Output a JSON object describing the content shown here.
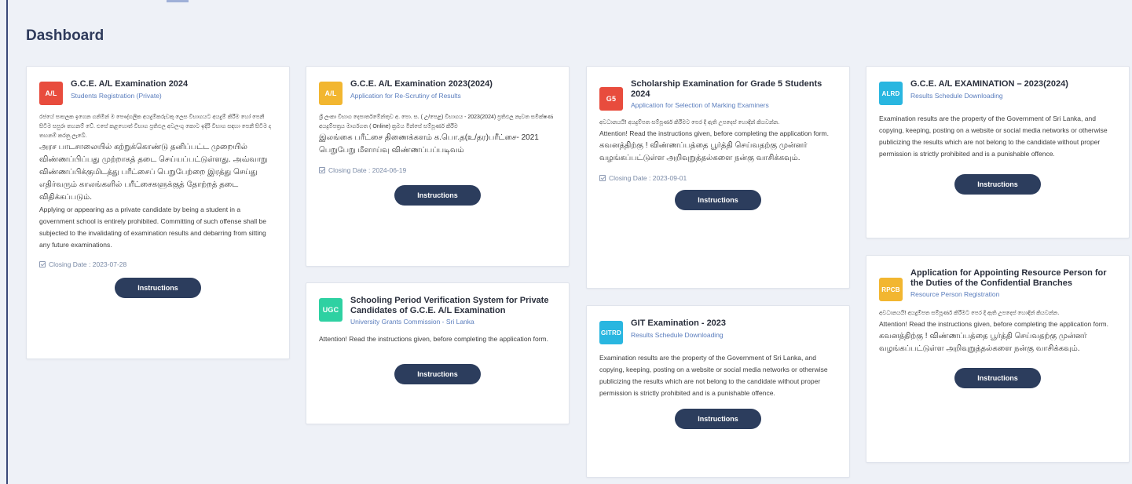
{
  "page": {
    "title": "Dashboard"
  },
  "instructions_label": "Instructions",
  "cards": {
    "al2024": {
      "badge": "A/L",
      "badge_color": "#e84c3d",
      "title": "G.C.E. A/L Examination 2024",
      "subtitle": "Students Registration (Private)",
      "sinhala": "රජයේ පාසලක ඉගෙන ගනිමින් ම පෞද්ගලික අයදුම්කරුවකු ලෙස විභාගයට අයදුම් කිරීම හෝ පෙනී සිටීම සපුරා තහනම් වේ. එසේ කළහොත් විභාග ප්‍රතිඵල අවලංගු කොට ඉදිරි විභාග සඳහා පෙනී සිටීම ද තහනම් කරනු ලැබේ.",
      "tamil": "அரச பாடசாலையில் கற்றுக்கொண்டு தனிப்பட்ட முறையில் விண்ணப்பிப்பது முற்றாகத் தடை செய்யப்பட்டுள்ளது. அவ்வாறு விண்ணப்பிக்குமிடத்து பரீட்சைப் பெறுபேற்றை இரத்து செய்து எதிர்வரும் காலங்களில் பரீட்சைகளுக்குத் தோற்றத் தடை விதிக்கப்படும்.",
      "english": "Applying or appearing as a private candidate by being a student in a government school is entirely prohibited. Committing of such offense shall be subjected to the invalidating of examination results and debarring from sitting any future examinations.",
      "closing": "Closing Date : 2023-07-28"
    },
    "al2023": {
      "badge": "A/L",
      "badge_color": "#f2b630",
      "title": "G.C.E. A/L Examination 2023(2024)",
      "subtitle": "Application for Re-Scrutiny of Results",
      "sinhala": "ශ්‍රී ලංකා විභාග දෙපාර්තමේන්තුව අ. පො. ස. ( උ/පෙළ) විභාගය - 2023(2024) ප්‍රතිඵල නැවත සමීක්ෂණ අයදුම්පත්‍රය මාර්ගගත ( Online) ක්‍රමය මින්සේ සම්පූර්ණ කිරීම",
      "tamil": "இலங்கை பரீட்சை திணைக்களம் க.பொ.த(உ/தர)பரீட்சை- 2021 பெறுபேறு மீளாய்வு விண்ணப்பப்படிவம்",
      "closing": "Closing Date : 2024-06-19"
    },
    "ugc": {
      "badge": "UGC",
      "badge_color": "#2ed1a2",
      "title": "Schooling Period Verification System for Private Candidates of G.C.E. A/L Examination",
      "subtitle": "University Grants Commission - Sri Lanka",
      "english": "Attention! Read the instructions given, before completing the application form."
    },
    "g5": {
      "badge": "G5",
      "badge_color": "#e84c3d",
      "title": "Scholarship Examination for Grade 5 Students 2024",
      "subtitle": "Application for Selection of Marking Examiners",
      "sinhala": "අවධානයයි! අයදුම්පත සම්පූර්ණ කිරීමට පෙර දී ඇති උපදෙස් හොඳින් කියවන්න.",
      "english": "Attention! Read the instructions given, before completing the application form.",
      "tamil": "கவனத்திற்கு ! விண்ணப்பத்தை பூர்த்தி செய்வதற்கு முன்னர் வழங்கப்பட்டுள்ள அறிவுறுத்தல்களை நன்கு வாசிக்கவும்.",
      "closing": "Closing Date : 2023-09-01"
    },
    "git": {
      "badge": "GITRD",
      "badge_color": "#29b6e0",
      "title": "GIT Examination - 2023",
      "subtitle": "Results Schedule Downloading",
      "english": "Examination results are the property of the Government of Sri Lanka, and copying, keeping, posting on a website or social media networks or otherwise publicizing the results which are not belong to the candidate without proper permission is strictly prohibited and is a punishable offence."
    },
    "alrd": {
      "badge": "ALRD",
      "badge_color": "#29b6e0",
      "title": "G.C.E. A/L EXAMINATION – 2023(2024)",
      "subtitle": "Results Schedule Downloading",
      "english": "Examination results are the property of the Government of Sri Lanka, and copying, keeping, posting on a website or social media networks or otherwise publicizing the results which are not belong to the candidate without proper permission is strictly prohibited and is a punishable offence."
    },
    "rpcb": {
      "badge": "RPCB",
      "badge_color": "#f2b630",
      "title": "Application for Appointing Resource Person for the Duties of the Confidential Branches",
      "subtitle": "Resource Person Registration",
      "sinhala": "අවධානයයි! අයදුම්පත සම්පූර්ණ කිරීමට පෙර දී ඇති උපදෙස් හොඳින් කියවන්න.",
      "english": "Attention! Read the instructions given, before completing the application form.",
      "tamil": "கவனத்திற்கு ! விண்ணப்பத்தை பூர்த்தி செய்வதற்கு முன்னர் வழங்கப்பட்டுள்ள அறிவுறுத்தல்களை நன்கு வாசிக்கவும்."
    }
  }
}
